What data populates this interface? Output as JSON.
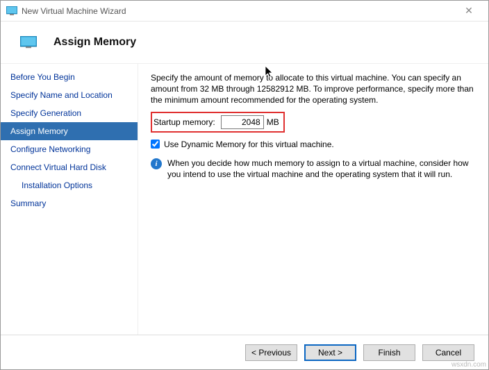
{
  "window": {
    "title": "New Virtual Machine Wizard",
    "close_glyph": "✕"
  },
  "header": {
    "title": "Assign Memory"
  },
  "sidebar": {
    "steps": [
      "Before You Begin",
      "Specify Name and Location",
      "Specify Generation",
      "Assign Memory",
      "Configure Networking",
      "Connect Virtual Hard Disk",
      "Installation Options",
      "Summary"
    ],
    "active_index": 3,
    "sub_indices": [
      6
    ]
  },
  "content": {
    "description": "Specify the amount of memory to allocate to this virtual machine. You can specify an amount from 32 MB through 12582912 MB. To improve performance, specify more than the minimum amount recommended for the operating system.",
    "startup_label": "Startup memory:",
    "startup_value": "2048",
    "startup_unit": "MB",
    "dynamic_label": "Use Dynamic Memory for this virtual machine.",
    "dynamic_checked": true,
    "info_text": "When you decide how much memory to assign to a virtual machine, consider how you intend to use the virtual machine and the operating system that it will run.",
    "info_glyph": "i"
  },
  "footer": {
    "previous": "< Previous",
    "next": "Next >",
    "finish": "Finish",
    "cancel": "Cancel"
  },
  "watermark": "wsxdn.com"
}
